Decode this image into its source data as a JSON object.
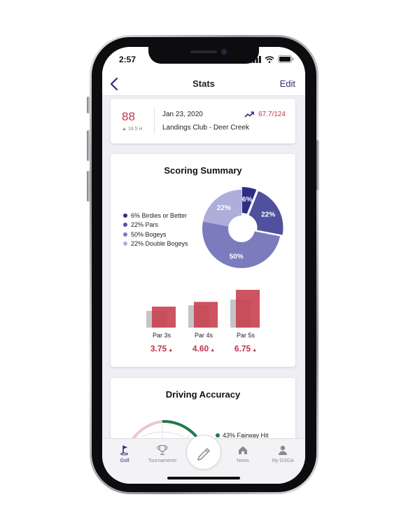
{
  "status_bar": {
    "time": "2:57"
  },
  "nav": {
    "title": "Stats",
    "edit_label": "Edit"
  },
  "round": {
    "score": "88",
    "handicap": "18.5 H",
    "date": "Jan 23, 2020",
    "course": "Landings Club - Deer Creek",
    "rating": "67.7/124"
  },
  "scoring_summary": {
    "title": "Scoring Summary",
    "legend": [
      {
        "label": "6% Birdies or Better",
        "color": "#2d2f86"
      },
      {
        "label": "22% Pars",
        "color": "#50519e"
      },
      {
        "label": "50% Bogeys",
        "color": "#7b7bbd"
      },
      {
        "label": "22% Double Bogeys",
        "color": "#aeaedb"
      }
    ],
    "pie_labels": [
      "6%",
      "22%",
      "50%",
      "22%"
    ],
    "par_labels": [
      "Par 3s",
      "Par 4s",
      "Par 5s"
    ],
    "par_averages": [
      "3.75",
      "4.60",
      "6.75"
    ]
  },
  "chart_data": [
    {
      "type": "pie",
      "title": "Scoring Summary",
      "series": [
        {
          "name": "Birdies or Better",
          "value": 6,
          "color": "#2d2f86"
        },
        {
          "name": "Pars",
          "value": 22,
          "color": "#50519e"
        },
        {
          "name": "Bogeys",
          "value": 50,
          "color": "#7b7bbd"
        },
        {
          "name": "Double Bogeys",
          "value": 22,
          "color": "#aeaedb"
        }
      ]
    },
    {
      "type": "bar",
      "categories": [
        "Par 3s",
        "Par 4s",
        "Par 5s"
      ],
      "series": [
        {
          "values": [
            3.0,
            4.0,
            5.0
          ],
          "color": "#c4c4c8"
        },
        {
          "values": [
            3.75,
            4.6,
            6.75
          ],
          "color": "#c8414f"
        }
      ],
      "ylim": [
        0,
        7
      ]
    }
  ],
  "driving_accuracy": {
    "title": "Driving Accuracy",
    "fairway_label": "43% Fairway Hit",
    "fairway_color": "#1f7a4d"
  },
  "tabs": [
    {
      "label": "Golf",
      "icon": "golf-flag-icon",
      "active": true
    },
    {
      "label": "Tournaments",
      "icon": "trophy-icon",
      "active": false
    },
    {
      "label": "News",
      "icon": "home-icon",
      "active": false
    },
    {
      "label": "My GSGA",
      "icon": "person-icon",
      "active": false
    }
  ],
  "colors": {
    "accent": "#2d2f7a",
    "score_red": "#c0334a"
  }
}
